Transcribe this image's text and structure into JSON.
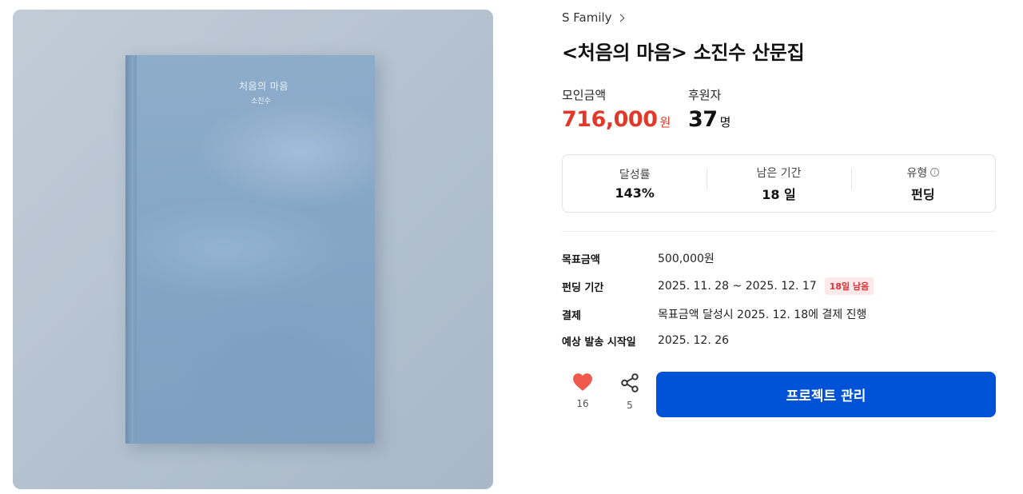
{
  "hero": {
    "book_title": "처음의 마음",
    "book_author": "소진수"
  },
  "breadcrumb": {
    "label": "S Family",
    "icon": "chevron-right-icon"
  },
  "project": {
    "title": "<처음의 마음> 소진수 산문집"
  },
  "stats": {
    "raised_label": "모인금액",
    "raised_value": "716,000",
    "raised_unit": "원",
    "backers_label": "후원자",
    "backers_value": "37",
    "backers_unit": "명"
  },
  "info": {
    "rate_label": "달성률",
    "rate_value": "143%",
    "remaining_label": "남은 기간",
    "remaining_value": "18 일",
    "type_label": "유형",
    "type_icon": "info-icon",
    "type_value": "펀딩"
  },
  "details": {
    "goal_label": "목표금액",
    "goal_value": "500,000원",
    "period_label": "펀딩 기간",
    "period_value": "2025. 11. 28 ~ 2025. 12. 17",
    "period_badge": "18일 남음",
    "payment_label": "결제",
    "payment_value": "목표금액 달성시 2025. 12. 18에 결제 진행",
    "ship_label": "예상 발송 시작일",
    "ship_value": "2025. 12. 26"
  },
  "actions": {
    "like_icon": "heart-icon",
    "like_count": "16",
    "share_icon": "share-icon",
    "share_count": "5",
    "cta_label": "프로젝트 관리"
  },
  "colors": {
    "accent_red": "#e0392b",
    "cta_blue": "#0053d6",
    "badge_bg": "#fde9e9"
  }
}
